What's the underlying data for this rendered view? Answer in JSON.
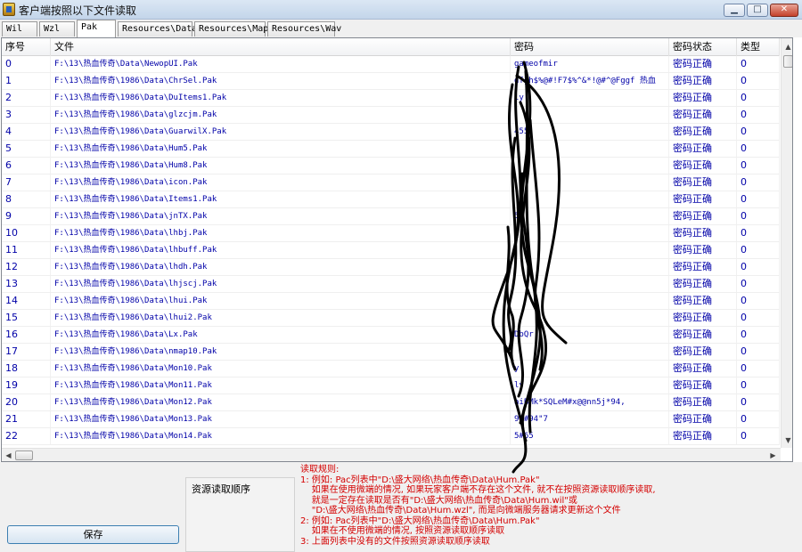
{
  "window": {
    "title": "客户端按照以下文件读取"
  },
  "tabs": [
    "Wil",
    "Wzl",
    "Pak",
    "Resources\\Data",
    "Resources\\Map",
    "Resources\\Wav"
  ],
  "active_tab": "Pak",
  "list": {
    "columns": [
      "序号",
      "文件",
      "密码",
      "密码状态",
      "类型"
    ],
    "rows": [
      {
        "id": "0",
        "file": "F:\\13\\热血传奇\\Data\\NewopUI.Pak",
        "pwd": "gameofmir",
        "status": "密码正确",
        "type": "0"
      },
      {
        "id": "1",
        "file": "F:\\13\\热血传奇\\1986\\Data\\ChrSel.Pak",
        "pwd": "dfgh$%@#!F7$%^&*!@#^@Fggf 热血",
        "status": "密码正确",
        "type": "0"
      },
      {
        "id": "2",
        "file": "F:\\13\\热血传奇\\1986\\Data\\DuItems1.Pak",
        "pwd": "ly",
        "status": "密码正确",
        "type": "0"
      },
      {
        "id": "3",
        "file": "F:\\13\\热血传奇\\1986\\Data\\glzcjm.Pak",
        "pwd": "",
        "status": "密码正确",
        "type": "0"
      },
      {
        "id": "4",
        "file": "F:\\13\\热血传奇\\1986\\Data\\GuarwilX.Pak",
        "pwd": "455",
        "status": "密码正确",
        "type": "0"
      },
      {
        "id": "5",
        "file": "F:\\13\\热血传奇\\1986\\Data\\Hum5.Pak",
        "pwd": "",
        "status": "密码正确",
        "type": "0"
      },
      {
        "id": "6",
        "file": "F:\\13\\热血传奇\\1986\\Data\\Hum8.Pak",
        "pwd": "",
        "status": "密码正确",
        "type": "0"
      },
      {
        "id": "7",
        "file": "F:\\13\\热血传奇\\1986\\Data\\icon.Pak",
        "pwd": "",
        "status": "密码正确",
        "type": "0"
      },
      {
        "id": "8",
        "file": "F:\\13\\热血传奇\\1986\\Data\\Items1.Pak",
        "pwd": "",
        "status": "密码正确",
        "type": "0"
      },
      {
        "id": "9",
        "file": "F:\\13\\热血传奇\\1986\\Data\\jnTX.Pak",
        "pwd": "5",
        "status": "密码正确",
        "type": "0"
      },
      {
        "id": "10",
        "file": "F:\\13\\热血传奇\\1986\\Data\\lhbj.Pak",
        "pwd": "",
        "status": "密码正确",
        "type": "0"
      },
      {
        "id": "11",
        "file": "F:\\13\\热血传奇\\1986\\Data\\lhbuff.Pak",
        "pwd": "",
        "status": "密码正确",
        "type": "0"
      },
      {
        "id": "12",
        "file": "F:\\13\\热血传奇\\1986\\Data\\lhdh.Pak",
        "pwd": "",
        "status": "密码正确",
        "type": "0"
      },
      {
        "id": "13",
        "file": "F:\\13\\热血传奇\\1986\\Data\\lhjscj.Pak",
        "pwd": "",
        "status": "密码正确",
        "type": "0"
      },
      {
        "id": "14",
        "file": "F:\\13\\热血传奇\\1986\\Data\\lhui.Pak",
        "pwd": "",
        "status": "密码正确",
        "type": "0"
      },
      {
        "id": "15",
        "file": "F:\\13\\热血传奇\\1986\\Data\\lhui2.Pak",
        "pwd": "",
        "status": "密码正确",
        "type": "0"
      },
      {
        "id": "16",
        "file": "F:\\13\\热血传奇\\1986\\Data\\Lx.Pak",
        "pwd": "DbQr",
        "status": "密码正确",
        "type": "0"
      },
      {
        "id": "17",
        "file": "F:\\13\\热血传奇\\1986\\Data\\nmap10.Pak",
        "pwd": "",
        "status": "密码正确",
        "type": "0"
      },
      {
        "id": "18",
        "file": "F:\\13\\热血传奇\\1986\\Data\\Mon10.Pak",
        "pwd": "y",
        "status": "密码正确",
        "type": "0"
      },
      {
        "id": "19",
        "file": "F:\\13\\热血传奇\\1986\\Data\\Mon11.Pak",
        "pwd": "ly",
        "status": "密码正确",
        "type": "0"
      },
      {
        "id": "20",
        "file": "F:\\13\\热血传奇\\1986\\Data\\Mon12.Pak",
        "pwd": "aiBMk*SQLeM#x@@nn5j*94,",
        "status": "密码正确",
        "type": "0"
      },
      {
        "id": "21",
        "file": "F:\\13\\热血传奇\\1986\\Data\\Mon13.Pak",
        "pwd": "91#94\"7",
        "status": "密码正确",
        "type": "0"
      },
      {
        "id": "22",
        "file": "F:\\13\\热血传奇\\1986\\Data\\Mon14.Pak",
        "pwd": "5#65",
        "status": "密码正确",
        "type": "0"
      }
    ]
  },
  "save_label": "保存",
  "order_label": "资源读取顺序",
  "rules": [
    "读取规则:",
    "1: 例如: Pac列表中\"D:\\盛大网络\\热血传奇\\Data\\Hum.Pak\"",
    "    如果在使用微端的情况, 如果玩家客户端不存在这个文件, 就不在按照资源读取顺序读取,",
    "    就是一定存在读取是否有\"D:\\盛大网络\\热血传奇\\Data\\Hum.wil\"或",
    "    \"D:\\盛大网络\\热血传奇\\Data\\Hum.wzl\", 而是向微端服务器请求更新这个文件",
    "2: 例如: Pac列表中\"D:\\盛大网络\\热血传奇\\Data\\Hum.Pak\"",
    "    如果在不使用微端的情况, 按照资源读取顺序读取",
    "3: 上面列表中没有的文件按照资源读取顺序读取"
  ],
  "colors": {
    "text_blue": "#0000a8",
    "rules_red": "#d40000"
  }
}
